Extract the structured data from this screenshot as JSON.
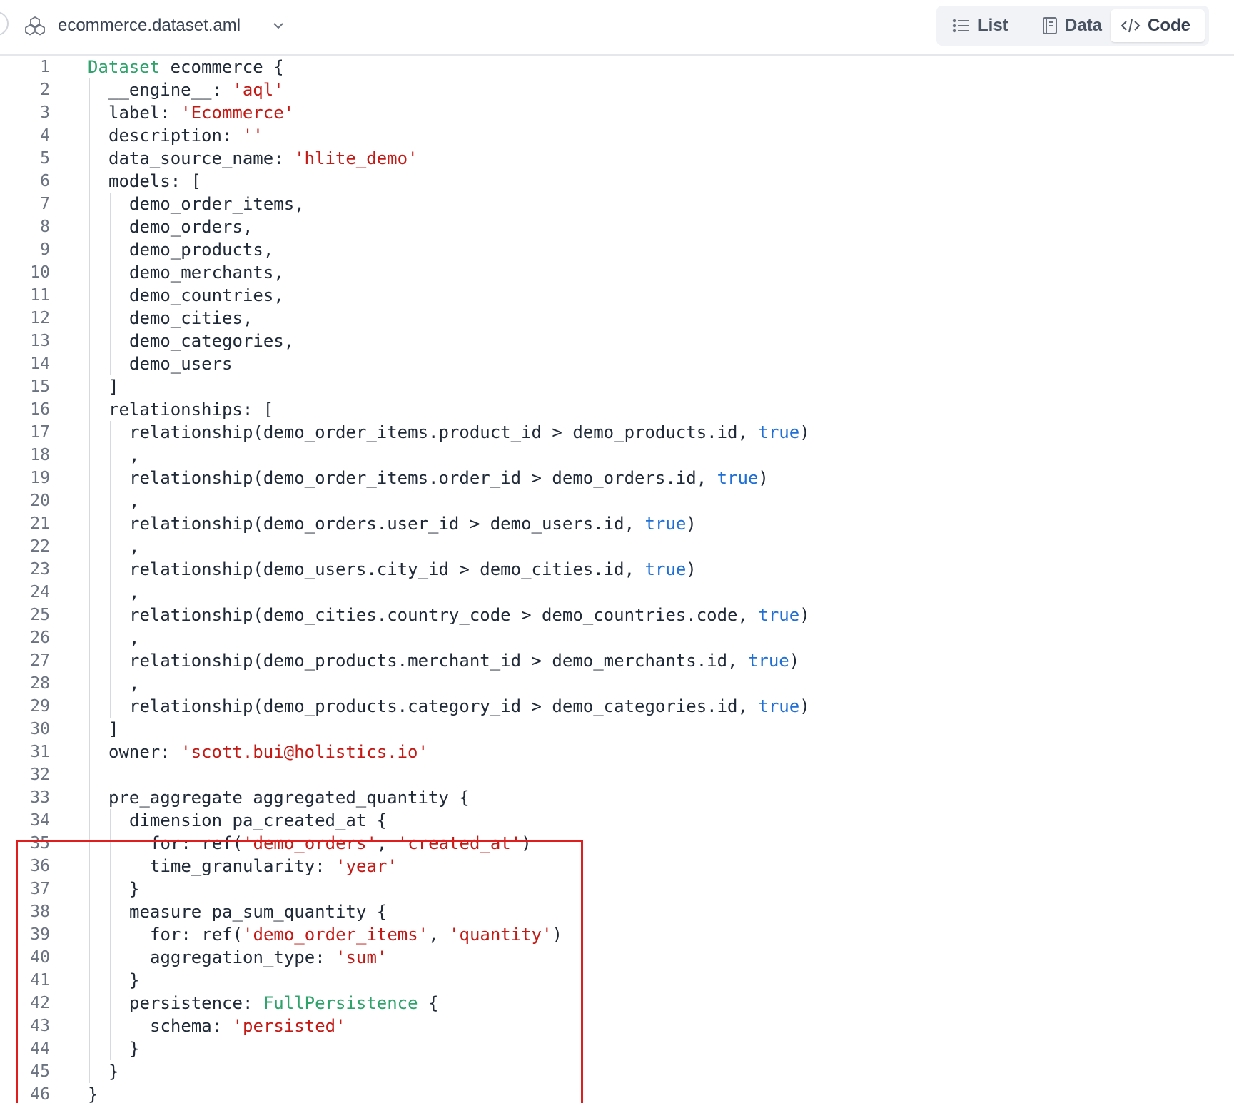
{
  "header": {
    "file_name": "ecommerce.dataset.aml",
    "file_icon": "dataset-icon",
    "view_switch": [
      {
        "label": "List",
        "icon": "list-icon",
        "active": false
      },
      {
        "label": "Data",
        "icon": "data-icon",
        "active": false
      },
      {
        "label": "Code",
        "icon": "code-icon",
        "active": true
      }
    ]
  },
  "colors": {
    "keyword": "#2fa36b",
    "string": "#c41a16",
    "boolean": "#1f6fd6",
    "highlight": "#e01e1e"
  },
  "highlight": {
    "from_line": 33,
    "to_line": 45
  },
  "code_lines": [
    {
      "n": "1",
      "indent": 0,
      "tokens": [
        {
          "t": "Dataset",
          "c": "kw"
        },
        {
          "t": " ecommerce {"
        }
      ]
    },
    {
      "n": "2",
      "indent": 1,
      "tokens": [
        {
          "t": "__engine__: "
        },
        {
          "t": "'aql'",
          "c": "str"
        }
      ]
    },
    {
      "n": "3",
      "indent": 1,
      "tokens": [
        {
          "t": "label: "
        },
        {
          "t": "'Ecommerce'",
          "c": "str"
        }
      ]
    },
    {
      "n": "4",
      "indent": 1,
      "tokens": [
        {
          "t": "description: "
        },
        {
          "t": "''",
          "c": "str"
        }
      ]
    },
    {
      "n": "5",
      "indent": 1,
      "tokens": [
        {
          "t": "data_source_name: "
        },
        {
          "t": "'hlite_demo'",
          "c": "str"
        }
      ]
    },
    {
      "n": "6",
      "indent": 1,
      "tokens": [
        {
          "t": "models: ["
        }
      ]
    },
    {
      "n": "7",
      "indent": 2,
      "tokens": [
        {
          "t": "demo_order_items,"
        }
      ]
    },
    {
      "n": "8",
      "indent": 2,
      "tokens": [
        {
          "t": "demo_orders,"
        }
      ]
    },
    {
      "n": "9",
      "indent": 2,
      "tokens": [
        {
          "t": "demo_products,"
        }
      ]
    },
    {
      "n": "10",
      "indent": 2,
      "tokens": [
        {
          "t": "demo_merchants,"
        }
      ]
    },
    {
      "n": "11",
      "indent": 2,
      "tokens": [
        {
          "t": "demo_countries,"
        }
      ]
    },
    {
      "n": "12",
      "indent": 2,
      "tokens": [
        {
          "t": "demo_cities,"
        }
      ]
    },
    {
      "n": "13",
      "indent": 2,
      "tokens": [
        {
          "t": "demo_categories,"
        }
      ]
    },
    {
      "n": "14",
      "indent": 2,
      "tokens": [
        {
          "t": "demo_users"
        }
      ]
    },
    {
      "n": "15",
      "indent": 1,
      "tokens": [
        {
          "t": "]"
        }
      ]
    },
    {
      "n": "16",
      "indent": 1,
      "tokens": [
        {
          "t": "relationships: ["
        }
      ]
    },
    {
      "n": "17",
      "indent": 2,
      "tokens": [
        {
          "t": "relationship(demo_order_items.product_id > demo_products.id, "
        },
        {
          "t": "true",
          "c": "bool"
        },
        {
          "t": ")"
        }
      ]
    },
    {
      "n": "18",
      "indent": 2,
      "tokens": [
        {
          "t": ","
        }
      ]
    },
    {
      "n": "19",
      "indent": 2,
      "tokens": [
        {
          "t": "relationship(demo_order_items.order_id > demo_orders.id, "
        },
        {
          "t": "true",
          "c": "bool"
        },
        {
          "t": ")"
        }
      ]
    },
    {
      "n": "20",
      "indent": 2,
      "tokens": [
        {
          "t": ","
        }
      ]
    },
    {
      "n": "21",
      "indent": 2,
      "tokens": [
        {
          "t": "relationship(demo_orders.user_id > demo_users.id, "
        },
        {
          "t": "true",
          "c": "bool"
        },
        {
          "t": ")"
        }
      ]
    },
    {
      "n": "22",
      "indent": 2,
      "tokens": [
        {
          "t": ","
        }
      ]
    },
    {
      "n": "23",
      "indent": 2,
      "tokens": [
        {
          "t": "relationship(demo_users.city_id > demo_cities.id, "
        },
        {
          "t": "true",
          "c": "bool"
        },
        {
          "t": ")"
        }
      ]
    },
    {
      "n": "24",
      "indent": 2,
      "tokens": [
        {
          "t": ","
        }
      ]
    },
    {
      "n": "25",
      "indent": 2,
      "tokens": [
        {
          "t": "relationship(demo_cities.country_code > demo_countries.code, "
        },
        {
          "t": "true",
          "c": "bool"
        },
        {
          "t": ")"
        }
      ]
    },
    {
      "n": "26",
      "indent": 2,
      "tokens": [
        {
          "t": ","
        }
      ]
    },
    {
      "n": "27",
      "indent": 2,
      "tokens": [
        {
          "t": "relationship(demo_products.merchant_id > demo_merchants.id, "
        },
        {
          "t": "true",
          "c": "bool"
        },
        {
          "t": ")"
        }
      ]
    },
    {
      "n": "28",
      "indent": 2,
      "tokens": [
        {
          "t": ","
        }
      ]
    },
    {
      "n": "29",
      "indent": 2,
      "tokens": [
        {
          "t": "relationship(demo_products.category_id > demo_categories.id, "
        },
        {
          "t": "true",
          "c": "bool"
        },
        {
          "t": ")"
        }
      ]
    },
    {
      "n": "30",
      "indent": 1,
      "tokens": [
        {
          "t": "]"
        }
      ]
    },
    {
      "n": "31",
      "indent": 1,
      "tokens": [
        {
          "t": "owner: "
        },
        {
          "t": "'scott.bui@holistics.io'",
          "c": "str"
        }
      ]
    },
    {
      "n": "32",
      "indent": 1,
      "tokens": []
    },
    {
      "n": "33",
      "indent": 1,
      "tokens": [
        {
          "t": "pre_aggregate aggregated_quantity {"
        }
      ]
    },
    {
      "n": "34",
      "indent": 2,
      "tokens": [
        {
          "t": "dimension pa_created_at {"
        }
      ]
    },
    {
      "n": "35",
      "indent": 3,
      "tokens": [
        {
          "t": "for: ref("
        },
        {
          "t": "'demo_orders'",
          "c": "str"
        },
        {
          "t": ", "
        },
        {
          "t": "'created_at'",
          "c": "str"
        },
        {
          "t": ")"
        }
      ]
    },
    {
      "n": "36",
      "indent": 3,
      "tokens": [
        {
          "t": "time_granularity: "
        },
        {
          "t": "'year'",
          "c": "str"
        }
      ]
    },
    {
      "n": "37",
      "indent": 2,
      "tokens": [
        {
          "t": "}"
        }
      ]
    },
    {
      "n": "38",
      "indent": 2,
      "tokens": [
        {
          "t": "measure pa_sum_quantity {"
        }
      ]
    },
    {
      "n": "39",
      "indent": 3,
      "tokens": [
        {
          "t": "for: ref("
        },
        {
          "t": "'demo_order_items'",
          "c": "str"
        },
        {
          "t": ", "
        },
        {
          "t": "'quantity'",
          "c": "str"
        },
        {
          "t": ")"
        }
      ]
    },
    {
      "n": "40",
      "indent": 3,
      "tokens": [
        {
          "t": "aggregation_type: "
        },
        {
          "t": "'sum'",
          "c": "str"
        }
      ]
    },
    {
      "n": "41",
      "indent": 2,
      "tokens": [
        {
          "t": "}"
        }
      ]
    },
    {
      "n": "42",
      "indent": 2,
      "tokens": [
        {
          "t": "persistence: "
        },
        {
          "t": "FullPersistence",
          "c": "kw"
        },
        {
          "t": " {"
        }
      ]
    },
    {
      "n": "43",
      "indent": 3,
      "tokens": [
        {
          "t": "schema: "
        },
        {
          "t": "'persisted'",
          "c": "str"
        }
      ]
    },
    {
      "n": "44",
      "indent": 2,
      "tokens": [
        {
          "t": "}"
        }
      ]
    },
    {
      "n": "45",
      "indent": 1,
      "tokens": [
        {
          "t": "}"
        }
      ]
    },
    {
      "n": "46",
      "indent": 0,
      "tokens": [
        {
          "t": "}"
        }
      ]
    }
  ]
}
